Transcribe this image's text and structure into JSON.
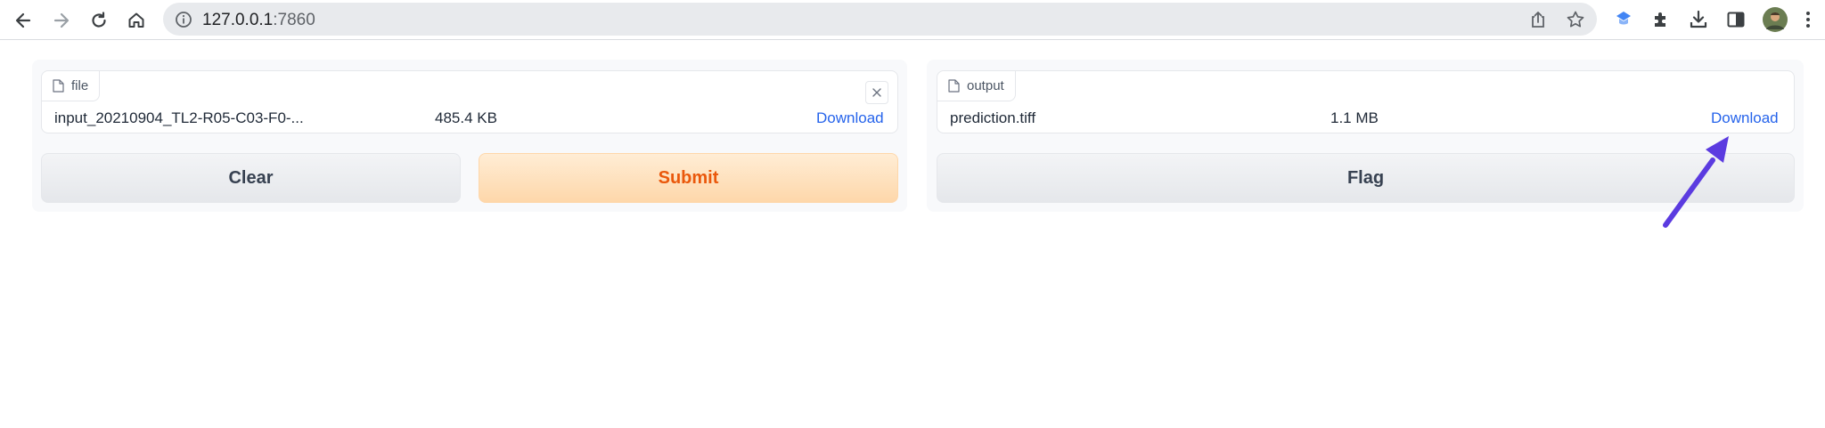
{
  "browser": {
    "url_host": "127.0.0.1",
    "url_port": ":7860",
    "icons": [
      "back-icon",
      "forward-icon",
      "reload-icon",
      "home-icon",
      "info-icon",
      "share-icon",
      "bookmark-star-icon",
      "extension-icon",
      "puzzle-icon",
      "download-icon",
      "sidepanel-icon",
      "profile-avatar"
    ]
  },
  "input_panel": {
    "file_label": "file",
    "file_name": "input_20210904_TL2-R05-C03-F0-...",
    "file_size": "485.4 KB",
    "download_label": "Download",
    "clear_label": "Clear",
    "submit_label": "Submit"
  },
  "output_panel": {
    "file_label": "output",
    "file_name": "prediction.tiff",
    "file_size": "1.1 MB",
    "download_label": "Download",
    "flag_label": "Flag"
  },
  "annotation": {
    "arrow_color": "#5b3be0"
  }
}
